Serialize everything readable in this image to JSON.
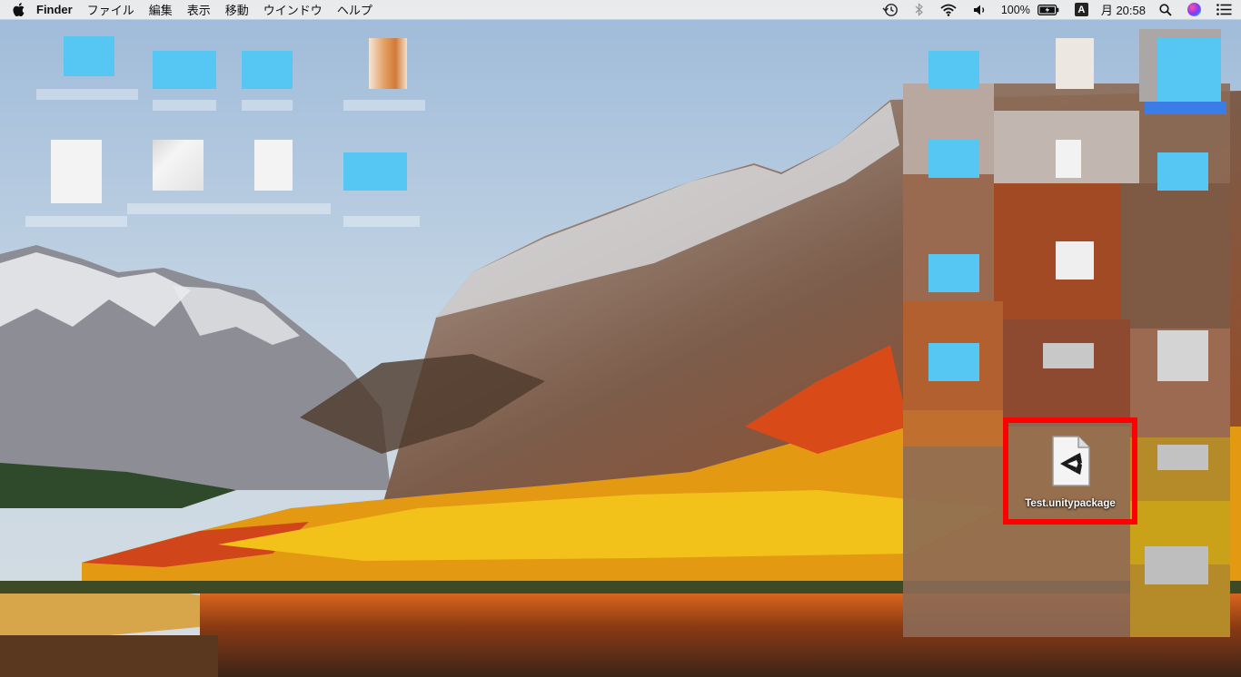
{
  "menubar": {
    "app_name": "Finder",
    "menus": [
      "ファイル",
      "編集",
      "表示",
      "移動",
      "ウインドウ",
      "ヘルプ"
    ],
    "status": {
      "battery": "100%",
      "input_source": "A",
      "clock": "月 20:58"
    },
    "icons": [
      "apple-icon",
      "time-machine-icon",
      "bluetooth-icon",
      "wifi-icon",
      "volume-icon",
      "battery-icon",
      "input-source-icon",
      "spotlight-icon",
      "siri-icon",
      "notification-center-icon"
    ]
  },
  "desktop": {
    "highlighted_file": {
      "name": "Test.unitypackage",
      "icon": "unity-package-icon",
      "highlight_color": "#ff0000"
    }
  },
  "colors": {
    "menubar_bg": "#ececec",
    "folder_blue": "#56c6f2",
    "highlight": "#ff0000"
  }
}
